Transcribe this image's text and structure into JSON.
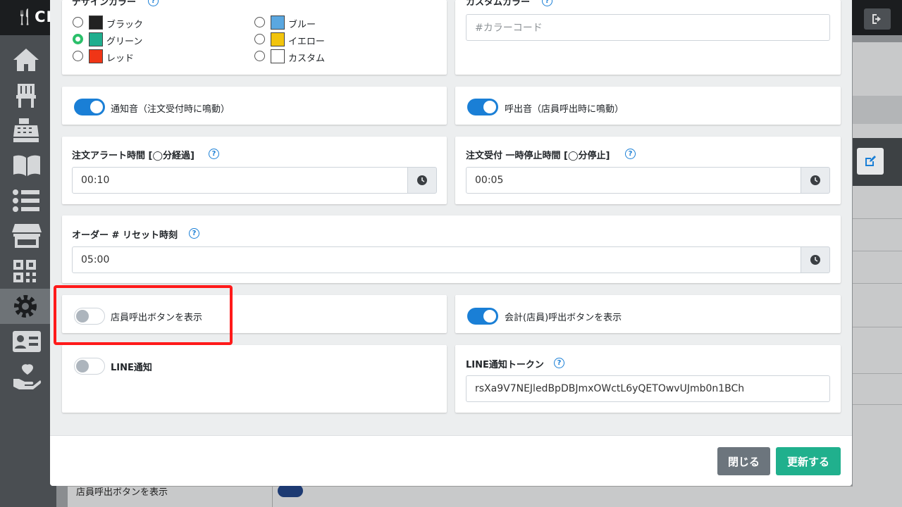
{
  "app": {
    "logo": "🍴CL"
  },
  "background": {
    "bottom_row_label": "店員呼出ボタンを表示"
  },
  "sidebar": {
    "items": [
      {
        "icon": "home-icon"
      },
      {
        "icon": "chair-icon"
      },
      {
        "icon": "register-icon"
      },
      {
        "icon": "book-icon"
      },
      {
        "icon": "list-icon"
      },
      {
        "icon": "store-icon"
      },
      {
        "icon": "qr-icon"
      },
      {
        "icon": "gear-icon",
        "active": true
      },
      {
        "icon": "id-card-icon"
      },
      {
        "icon": "hand-heart-icon"
      }
    ]
  },
  "design_color": {
    "label": "デザインカラー",
    "options": [
      {
        "label": "ブラック",
        "color": "#222222",
        "checked": false
      },
      {
        "label": "グリーン",
        "color": "#1fae8e",
        "checked": true
      },
      {
        "label": "レッド",
        "color": "#f03516",
        "checked": false
      },
      {
        "label": "ブルー",
        "color": "#5aa7e0",
        "checked": false
      },
      {
        "label": "イエロー",
        "color": "#f2c40d",
        "checked": false
      },
      {
        "label": "カスタム",
        "color": "#ffffff",
        "checked": false
      }
    ]
  },
  "custom_color": {
    "label": "カスタムカラー",
    "placeholder": "#カラーコード"
  },
  "notify_sound": {
    "label": "通知音（注文受付時に鳴動）",
    "on": true
  },
  "call_sound": {
    "label": "呼出音（店員呼出時に鳴動）",
    "on": true
  },
  "order_alert": {
    "label": "注文アラート時間 [◯分経過]",
    "value": "00:10"
  },
  "order_pause": {
    "label": "注文受付 一時停止時間 [◯分停止]",
    "value": "00:05"
  },
  "order_reset": {
    "label": "オーダー # リセット時刻",
    "value": "05:00"
  },
  "staff_call_btn": {
    "label": "店員呼出ボタンを表示",
    "on": false
  },
  "checkout_btn": {
    "label": "会計(店員)呼出ボタンを表示",
    "on": true
  },
  "line_notify": {
    "label": "LINE通知",
    "on": false
  },
  "line_token": {
    "label": "LINE通知トークン",
    "value": "rsXa9V7NEJledBpDBJmxOWctL6yQETOwvUJmb0n1BCh"
  },
  "footer": {
    "close_label": "閉じる",
    "update_label": "更新する"
  },
  "colors": {
    "accent": "#1a7fd6",
    "primary_button": "#20b08d",
    "secondary_button": "#6c757d",
    "highlight": "#ff1a1a"
  }
}
